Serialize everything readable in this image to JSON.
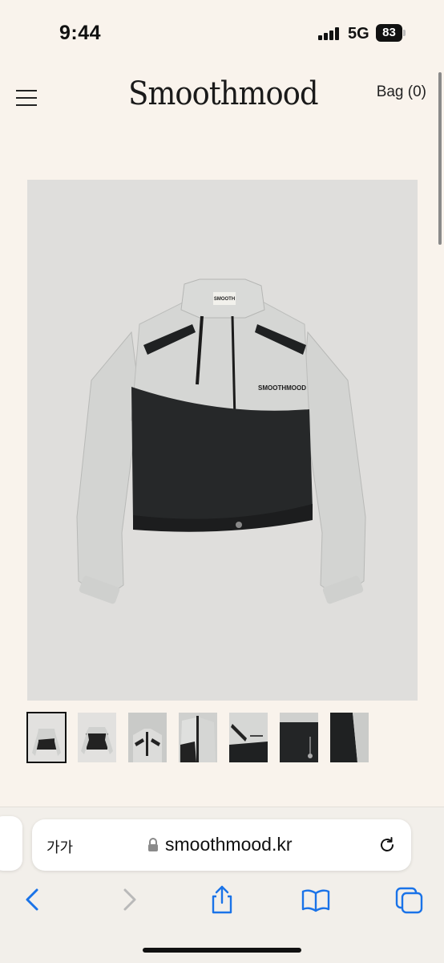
{
  "status_bar": {
    "time": "9:44",
    "network": "5G",
    "battery": "83"
  },
  "header": {
    "logo": "Smoothmood",
    "bag_label": "Bag (0)"
  },
  "product": {
    "image_icon": "jacket-photo",
    "jacket_logo": "SMOOTHMOOD",
    "thumbnails": [
      "thumb-front",
      "thumb-back",
      "thumb-collar",
      "thumb-zipper",
      "thumb-logo",
      "thumb-hem",
      "thumb-sleeve"
    ],
    "selected_thumbnail": 0
  },
  "browser": {
    "text_size_label": "가가",
    "url": "smoothmood.kr",
    "icons": {
      "lock": "lock-icon",
      "reload": "reload-icon",
      "back": "back-icon",
      "forward": "forward-icon",
      "share": "share-icon",
      "bookmarks": "bookmarks-icon",
      "tabs": "tabs-icon"
    },
    "accent_color": "#1a73e8"
  },
  "colors": {
    "background": "#f9f3ec",
    "jacket_light": "#d3d4d2",
    "jacket_dark": "#262829"
  }
}
